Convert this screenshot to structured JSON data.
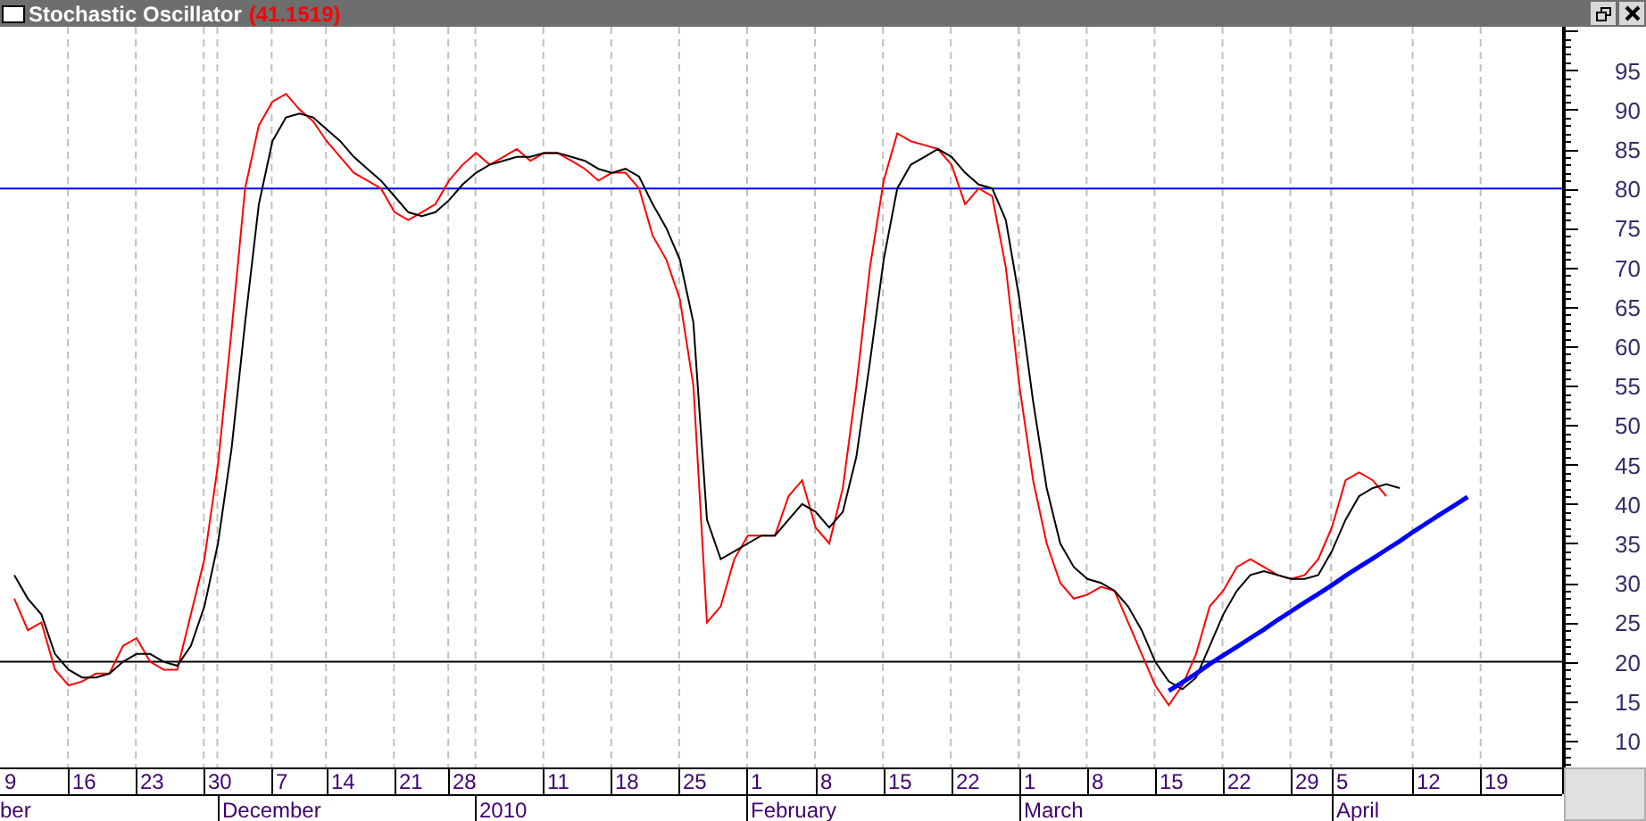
{
  "window": {
    "title": "Stochastic Oscillator",
    "value": "(41.1519)"
  },
  "chart": {
    "chart_data": {
      "type": "line",
      "grid": true,
      "ylim": [
        6.6,
        100.5
      ],
      "categories": [
        "9",
        null,
        null,
        null,
        null,
        "16",
        null,
        null,
        null,
        null,
        "23",
        null,
        null,
        null,
        null,
        "30",
        null,
        null,
        null,
        null,
        "7",
        null,
        null,
        null,
        "14",
        null,
        null,
        null,
        null,
        "21",
        null,
        null,
        null,
        "28",
        null,
        null,
        null,
        null,
        null,
        null,
        "11",
        null,
        null,
        null,
        null,
        "18",
        null,
        null,
        null,
        null,
        "25",
        null,
        null,
        null,
        null,
        "1",
        null,
        null,
        null,
        null,
        "8",
        null,
        null,
        null,
        null,
        "15",
        null,
        null,
        null,
        null,
        "22",
        null,
        null,
        null,
        null,
        "1",
        null,
        null,
        null,
        null,
        "8",
        null,
        null,
        null,
        null,
        "15",
        null,
        null,
        null,
        null,
        "22",
        null,
        null,
        null,
        null,
        "29",
        null,
        null,
        "5",
        null,
        null,
        null,
        null,
        null,
        "12",
        null,
        null,
        null,
        null,
        "19",
        null,
        null,
        null,
        null,
        null
      ],
      "yticks": [
        10,
        15,
        20,
        25,
        30,
        35,
        40,
        45,
        50,
        55,
        60,
        65,
        70,
        75,
        80,
        85,
        90,
        95
      ],
      "ref_lines": [
        {
          "axis": "y",
          "value": 80,
          "color": "#0000ff"
        },
        {
          "axis": "y",
          "value": 20,
          "color": "#000000"
        }
      ],
      "series": [
        {
          "color": "#ff0000",
          "values": [
            28,
            24,
            25,
            19,
            17,
            17.5,
            18.5,
            18.5,
            22,
            23,
            20,
            19,
            19,
            26,
            33,
            45,
            62,
            80,
            88,
            91,
            92,
            90,
            88.5,
            86,
            84,
            82,
            81,
            80,
            77,
            76,
            77,
            78,
            81,
            83,
            84.5,
            83,
            84,
            85,
            83.5,
            84.5,
            84.5,
            83.5,
            82.5,
            81,
            82,
            82,
            80,
            74,
            71,
            66,
            55,
            25,
            27,
            33,
            36,
            36,
            36,
            41,
            43,
            37,
            35,
            42,
            55,
            70,
            81,
            87,
            86,
            85.5,
            85,
            83,
            78,
            80,
            79,
            70,
            55,
            43,
            35,
            30,
            28,
            28.5,
            29.5,
            29,
            25,
            21,
            17,
            14.5,
            17,
            21,
            27,
            29,
            32,
            33,
            32,
            31,
            30.5,
            31,
            33,
            37,
            43,
            44,
            43,
            41,
            null,
            null,
            null,
            null,
            null,
            null,
            null,
            null,
            null,
            null,
            null,
            null,
            null
          ]
        },
        {
          "color": "#000000",
          "values": [
            31,
            28,
            26,
            21,
            19,
            18,
            18,
            18.5,
            20,
            21,
            21,
            20,
            19.5,
            22,
            27,
            35,
            47,
            63,
            78,
            86,
            89,
            89.5,
            89,
            87.5,
            86,
            84,
            82.5,
            81,
            79,
            77,
            76.5,
            77,
            78.5,
            80.5,
            82,
            83,
            83.5,
            84,
            84,
            84.5,
            84.5,
            84,
            83.5,
            82.5,
            82,
            82.5,
            81.5,
            78,
            75,
            71,
            63,
            38,
            33,
            34,
            35,
            36,
            36,
            38,
            40,
            39,
            37,
            39,
            46,
            58,
            71,
            80,
            83,
            84,
            85,
            84,
            82,
            80.5,
            80,
            76,
            66,
            53,
            42,
            35,
            32,
            30.5,
            30,
            29,
            27,
            24,
            20,
            17.5,
            16.5,
            18,
            22,
            26,
            29,
            31,
            31.5,
            31,
            30.5,
            30.5,
            31,
            34,
            38,
            41,
            42,
            42.5,
            42,
            null,
            null,
            null,
            null,
            null,
            null,
            null,
            null,
            null,
            null,
            null,
            null
          ]
        },
        {
          "color": "#0000ff",
          "values": [
            null,
            null,
            null,
            null,
            null,
            null,
            null,
            null,
            null,
            null,
            null,
            null,
            null,
            null,
            null,
            null,
            null,
            null,
            null,
            null,
            null,
            null,
            null,
            null,
            null,
            null,
            null,
            null,
            null,
            null,
            null,
            null,
            null,
            null,
            null,
            null,
            null,
            null,
            null,
            null,
            null,
            null,
            null,
            null,
            null,
            null,
            null,
            null,
            null,
            null,
            null,
            null,
            null,
            null,
            null,
            null,
            null,
            null,
            null,
            null,
            null,
            null,
            null,
            null,
            null,
            null,
            null,
            null,
            null,
            null,
            null,
            null,
            null,
            null,
            null,
            null,
            null,
            null,
            null,
            null,
            null,
            null,
            null,
            null,
            null,
            16.3,
            17.4,
            18.5,
            19.7,
            20.8,
            21.9,
            23.0,
            24.1,
            25.3,
            26.4,
            27.5,
            28.6,
            29.7,
            30.9,
            32.0,
            33.1,
            34.2,
            35.3,
            36.5,
            37.6,
            38.7,
            39.8,
            40.9,
            null,
            null,
            null,
            null,
            null,
            null,
            null
          ]
        }
      ]
    }
  },
  "months": [
    "ber",
    "December",
    "2010",
    "February",
    "March",
    "April"
  ]
}
